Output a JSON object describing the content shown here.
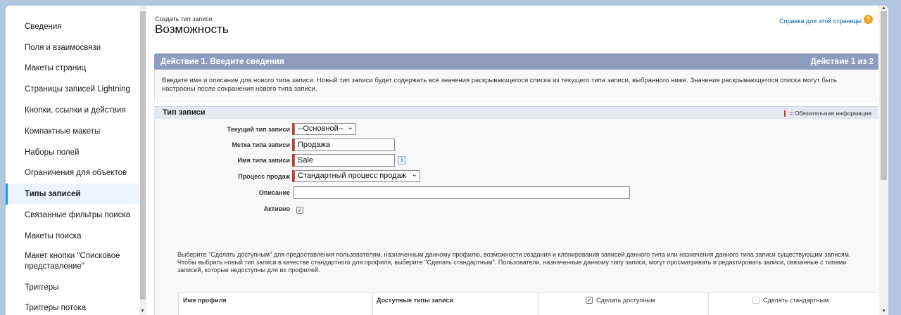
{
  "sidebar": {
    "items": [
      {
        "label": "Сведения"
      },
      {
        "label": "Поля и взаимосвязи"
      },
      {
        "label": "Макеты страниц"
      },
      {
        "label": "Страницы записей Lightning"
      },
      {
        "label": "Кнопки, ссылки и действия"
      },
      {
        "label": "Компактные макеты"
      },
      {
        "label": "Наборы полей"
      },
      {
        "label": "Ограничения для объектов"
      },
      {
        "label": "Типы записей"
      },
      {
        "label": "Связанные фильтры поиска"
      },
      {
        "label": "Макеты поиска"
      },
      {
        "label": "Макет кнопки \"Списковое представление\""
      },
      {
        "label": "Триггеры"
      },
      {
        "label": "Триггеры потока"
      }
    ],
    "active_index": 8
  },
  "header": {
    "breadcrumb": "Создать тип записи",
    "title": "Возможность",
    "help_link": "Справка для этой страницы",
    "help_icon": "question-circle-icon"
  },
  "step": {
    "title": "Действие 1. Введите сведения",
    "progress": "Действие 1 из 2",
    "description": "Введите имя и описание для нового типа записи. Новый тип записи будет содержать все значения раскрывающегося списка из текущего типа записи, выбранного ниже. Значения раскрывающегося списка могут быть настроены после сохранения нового типа записи."
  },
  "section": {
    "title": "Тип записи",
    "required_legend": "= Обязательная информация"
  },
  "form": {
    "current_type_label": "Текущий тип записи",
    "current_type_value": "--Основной--",
    "record_label_label": "Метка типа записи",
    "record_label_value": "Продажа",
    "record_name_label": "Имя типа записи",
    "record_name_value": "Sale",
    "sales_process_label": "Процесс продаж",
    "sales_process_value": "Стандартный процесс продаж",
    "description_label": "Описание",
    "description_value": "",
    "active_label": "Активно",
    "active_checked": true
  },
  "permissions": {
    "text": "Выберите \"Сделать доступным\" для предоставления пользователям, назначенным данному профилю, возможности создания и клонирования записей данного типа или назначения данного типа записи существующим записям. Чтобы выбрать новый тип записи в качестве стандартного для профиля, выберите \"Сделать стандартным\". Пользователи, назначенные данному типу записи, могут просматривать и редактировать записи, связанные с типами записей, которые недоступны для их профилей.",
    "col_profile": "Имя профиля",
    "col_available_types": "Доступные типы записи",
    "col_make_available": "Сделать доступным",
    "col_make_default": "Сделать стандартным",
    "make_available_checked": true,
    "make_default_checked": false
  }
}
